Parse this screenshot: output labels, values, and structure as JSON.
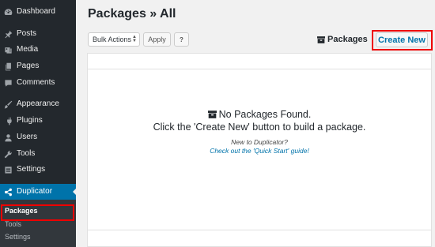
{
  "sidebar": {
    "items": [
      {
        "label": "Dashboard",
        "icon": "dashboard-icon"
      },
      {
        "label": "Posts",
        "icon": "pin-icon"
      },
      {
        "label": "Media",
        "icon": "media-icon"
      },
      {
        "label": "Pages",
        "icon": "pages-icon"
      },
      {
        "label": "Comments",
        "icon": "comment-icon"
      },
      {
        "label": "Appearance",
        "icon": "brush-icon"
      },
      {
        "label": "Plugins",
        "icon": "plug-icon"
      },
      {
        "label": "Users",
        "icon": "user-icon"
      },
      {
        "label": "Tools",
        "icon": "wrench-icon"
      },
      {
        "label": "Settings",
        "icon": "settings-icon"
      },
      {
        "label": "Duplicator",
        "icon": "share-icon"
      }
    ],
    "submenu": [
      "Packages",
      "Tools",
      "Settings"
    ]
  },
  "page": {
    "title": "Packages » All"
  },
  "toolbar": {
    "bulk_actions": "Bulk Actions",
    "apply_label": "Apply",
    "help_label": "?",
    "packages_label": "Packages",
    "create_new_label": "Create New"
  },
  "table": {
    "empty_title": "No Packages Found.",
    "empty_subtitle": "Click the 'Create New' button to build a package.",
    "new_to": "New to Duplicator?",
    "quick_start": "Check out the 'Quick Start' guide!"
  },
  "colors": {
    "sidebar_bg": "#23282d",
    "active_bg": "#0073aa",
    "link": "#0073aa",
    "highlight": "#e00000"
  }
}
